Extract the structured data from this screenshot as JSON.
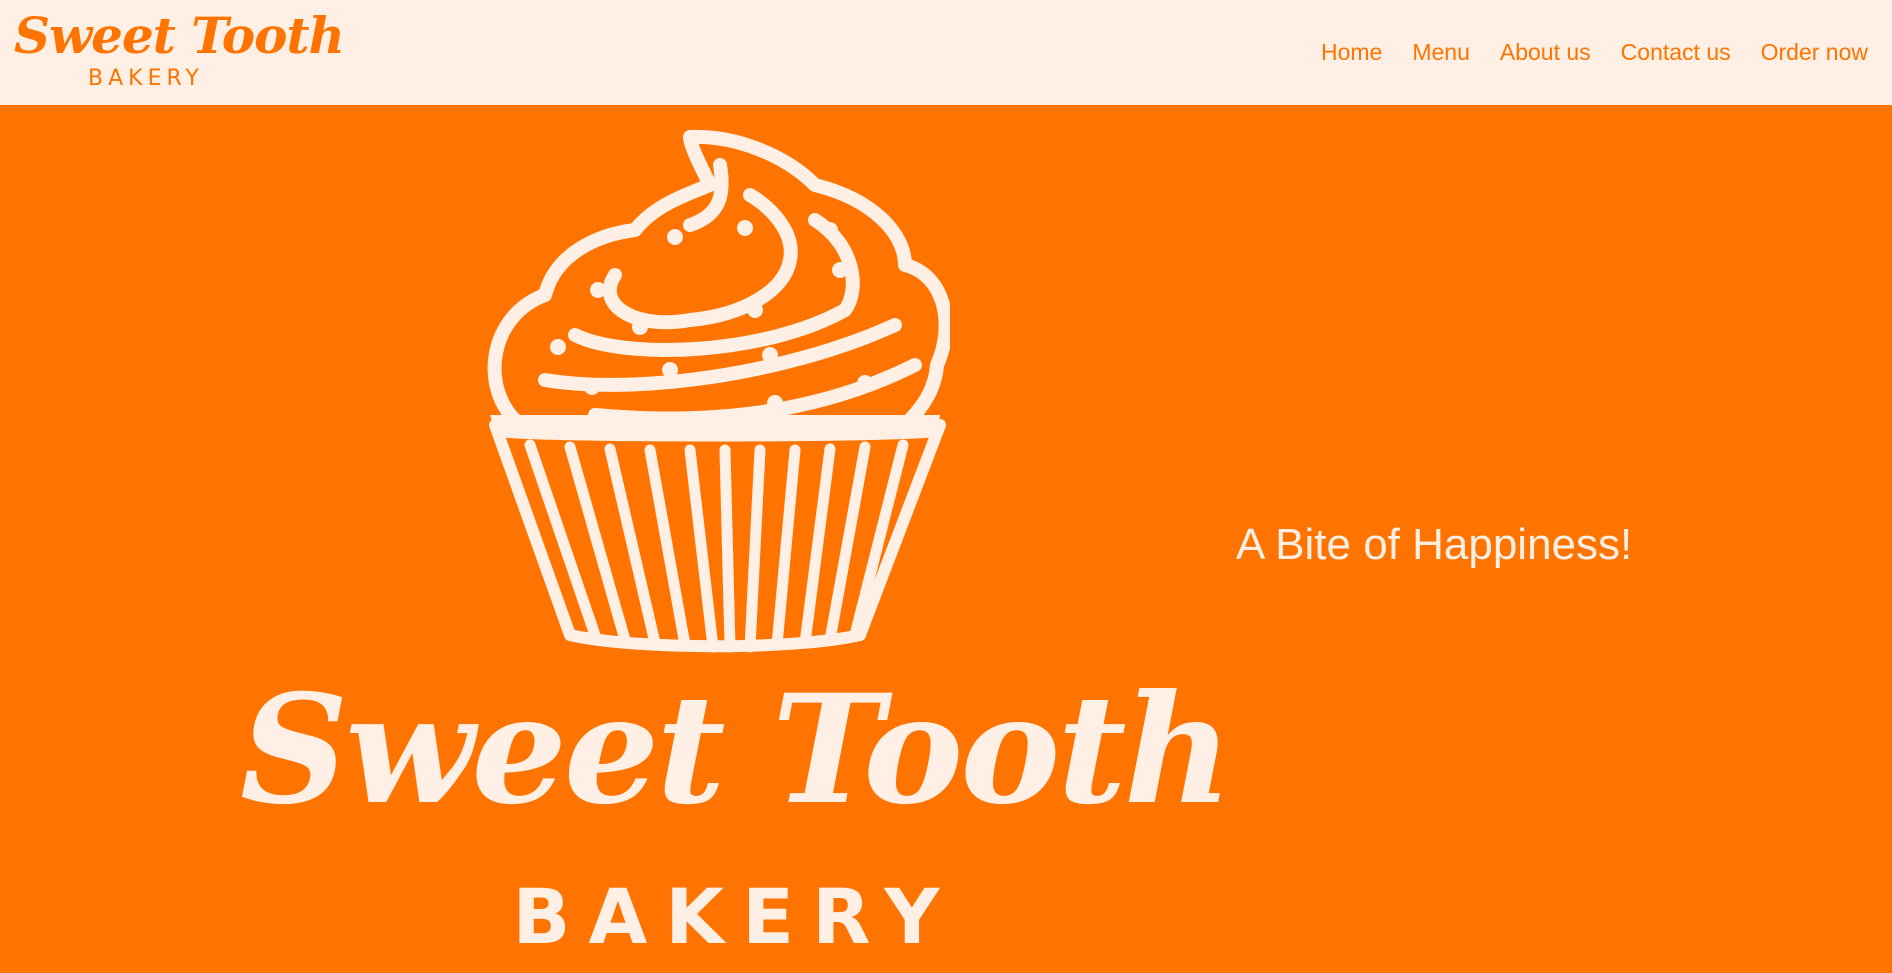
{
  "colors": {
    "brand_orange": "#ff7400",
    "cream": "#ffefe4"
  },
  "header": {
    "logo": {
      "script": "Sweet Tooth",
      "sub": "BAKERY"
    },
    "nav": [
      {
        "label": "Home"
      },
      {
        "label": "Menu"
      },
      {
        "label": "About us"
      },
      {
        "label": "Contact us"
      },
      {
        "label": "Order now"
      }
    ]
  },
  "hero": {
    "brand_script": "Sweet Tooth",
    "brand_sub": "BAKERY",
    "tagline": "A Bite of Happiness!",
    "illustration_icon": "cupcake-icon"
  }
}
